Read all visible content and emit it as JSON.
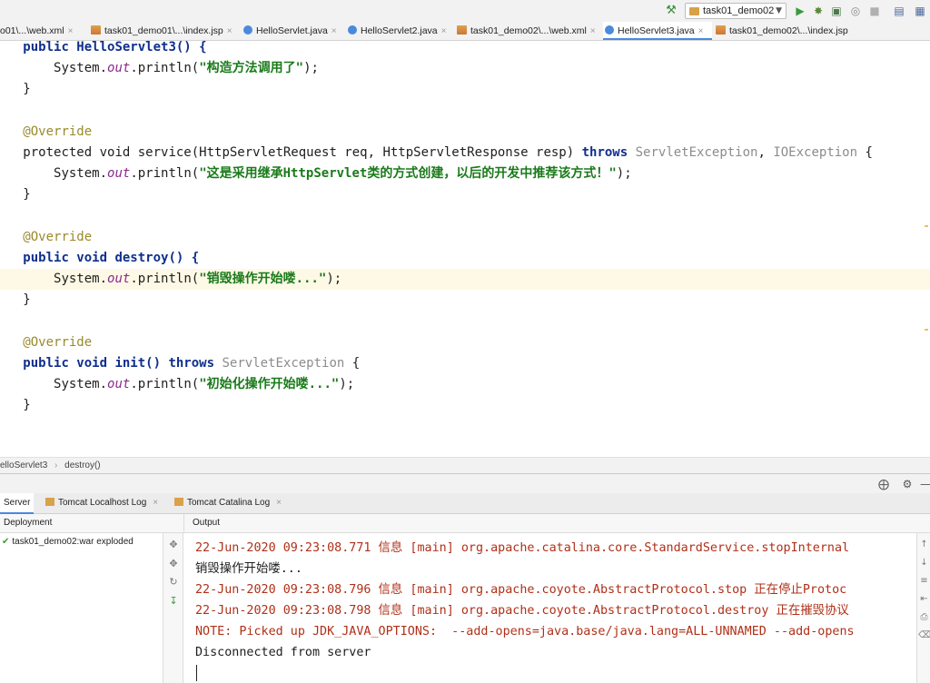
{
  "toolbar": {
    "run_config": "task01_demo02",
    "icons": [
      "hammer-icon",
      "run-icon",
      "debug-icon",
      "coverage-icon",
      "profile-icon",
      "stop-icon",
      "structure-icon",
      "layout-icon"
    ]
  },
  "tabs": [
    {
      "label": "o01\\...\\web.xml",
      "icon": "xml",
      "active": false
    },
    {
      "label": "task01_demo01\\...\\index.jsp",
      "icon": "xml",
      "active": false
    },
    {
      "label": "HelloServlet.java",
      "icon": "java",
      "active": false
    },
    {
      "label": "HelloServlet2.java",
      "icon": "java",
      "active": false
    },
    {
      "label": "task01_demo02\\...\\web.xml",
      "icon": "xml",
      "active": false
    },
    {
      "label": "HelloServlet3.java",
      "icon": "java",
      "active": true
    },
    {
      "label": "task01_demo02\\...\\index.jsp",
      "icon": "xml",
      "active": false
    }
  ],
  "code": {
    "ctor_sig": "public HelloServlet3() {",
    "ctor_print": "构造方法调用了",
    "override": "@Override",
    "service_sig_pre": "protected void service(HttpServletRequest req, HttpServletResponse resp) ",
    "service_throws": "throws",
    "service_ex1": "ServletException",
    "service_ex2": "IOException",
    "service_print": "这是采用继承HttpServlet类的方式创建，以后的开发中推荐该方式！",
    "destroy_sig": "public void destroy() {",
    "destroy_print": "销毁操作开始喽...",
    "init_sig_pre": "public void init() ",
    "init_throws": "throws",
    "init_ex": "ServletException",
    "init_print": "初始化操作开始喽...",
    "println_prefix": "System.",
    "out": "out",
    "println": ".println("
  },
  "breadcrumb": {
    "class": "elloServlet3",
    "method": "destroy()"
  },
  "services": {
    "tabs": [
      {
        "label": "Server",
        "active": true
      },
      {
        "label": "Tomcat Localhost Log",
        "active": false
      },
      {
        "label": "Tomcat Catalina Log",
        "active": false
      }
    ],
    "deployment_header": "Deployment",
    "output_header": "Output",
    "deployment_item": "task01_demo02:war exploded",
    "console": [
      {
        "text": "22-Jun-2020 09:23:08.771 信息 [main] org.apache.catalina.core.StandardService.stopInternal",
        "color": "red"
      },
      {
        "text": "销毁操作开始喽...",
        "color": "black"
      },
      {
        "text": "22-Jun-2020 09:23:08.796 信息 [main] org.apache.coyote.AbstractProtocol.stop 正在停止Protoc",
        "color": "red"
      },
      {
        "text": "22-Jun-2020 09:23:08.798 信息 [main] org.apache.coyote.AbstractProtocol.destroy 正在摧毁协议",
        "color": "red"
      },
      {
        "text": "NOTE: Picked up JDK_JAVA_OPTIONS:  --add-opens=java.base/java.lang=ALL-UNNAMED --add-opens",
        "color": "red"
      },
      {
        "text": "Disconnected from server",
        "color": "black"
      }
    ]
  }
}
